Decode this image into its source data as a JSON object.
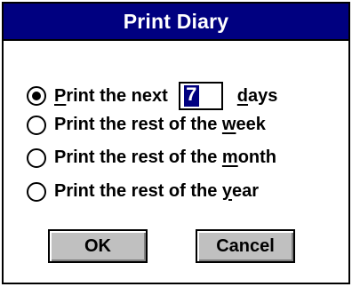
{
  "dialog": {
    "title": "Print Diary",
    "options": [
      {
        "prefix": "",
        "mnemonic": "P",
        "suffix": "rint the next",
        "selected": true
      },
      {
        "prefix": "Print the rest of the ",
        "mnemonic": "w",
        "suffix": "eek",
        "selected": false
      },
      {
        "prefix": "Print the rest of the ",
        "mnemonic": "m",
        "suffix": "onth",
        "selected": false
      },
      {
        "prefix": "Print the rest of the ",
        "mnemonic": "y",
        "suffix": "ear",
        "selected": false
      }
    ],
    "days_value": "7",
    "days_mnemonic": "d",
    "days_suffix": "ays",
    "ok_label": "OK",
    "cancel_label": "Cancel"
  },
  "colors": {
    "title_bar": "#000080",
    "title_text": "#ffffff",
    "button_face": "#c0c0c0",
    "selection": "#000080"
  }
}
